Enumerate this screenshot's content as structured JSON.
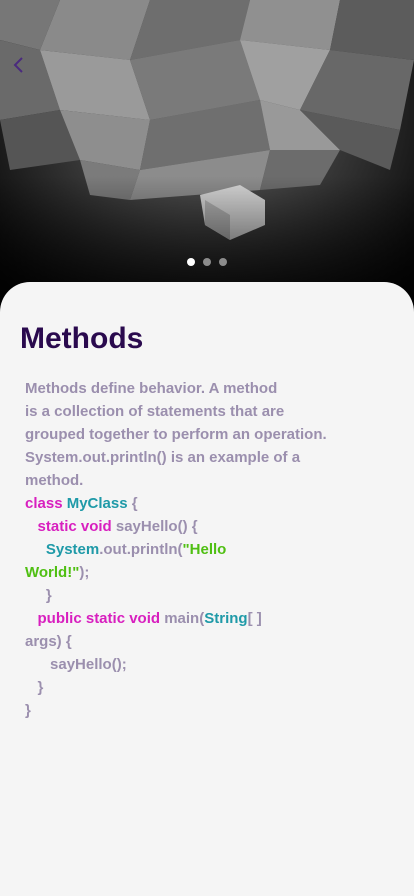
{
  "header": {
    "back_icon": "chevron-left-icon",
    "carousel": {
      "total": 3,
      "active_index": 0
    }
  },
  "lesson": {
    "title": "Methods",
    "description_lines": [
      "Methods define behavior. A method",
      "is a collection of statements that are",
      "grouped together to perform an operation.",
      "System.out.println() is an example of a",
      "method."
    ],
    "code": {
      "l1_kw": "class",
      "l1_cls": "MyClass",
      "l1_rest": " {",
      "l2_indent": "   ",
      "l2_kw": "static void",
      "l2_rest": " sayHello() {",
      "l3_indent": "     ",
      "l3_cls": "System",
      "l3_rest": ".out.println(",
      "l3_str": "\"Hello",
      "l4_str": "World!\"",
      "l4_rest": ");",
      "l5": "     }",
      "l6_indent": "   ",
      "l6_kw": "public static void",
      "l6_rest": " main(",
      "l6_cls": "String",
      "l6_end": "[ ]",
      "l7": "args) {",
      "l8": "      sayHello();",
      "l9": "   }",
      "l10": "}"
    }
  },
  "colors": {
    "title": "#2a0a4e",
    "text": "#9b8fae",
    "keyword": "#d81fbf",
    "class": "#1f9aa8",
    "string": "#4fbf12",
    "back_icon": "#4a2a7e"
  }
}
